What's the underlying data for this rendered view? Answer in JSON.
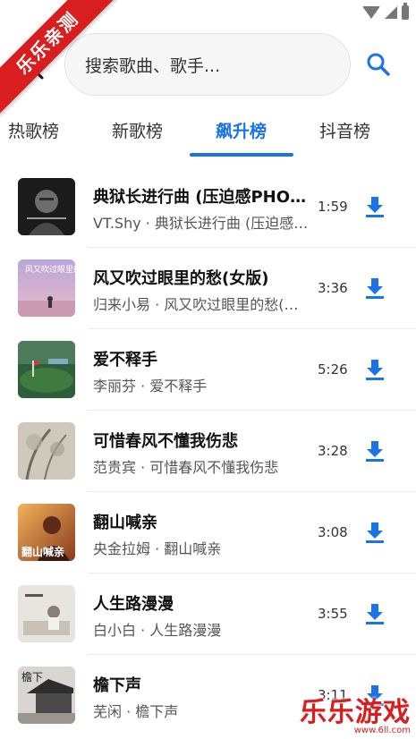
{
  "watermark": {
    "corner": "乐乐亲测",
    "bottom_title": "乐乐游戏",
    "bottom_url": "www.6ll.com"
  },
  "header": {
    "search_placeholder": "搜索歌曲、歌手..."
  },
  "tabs": [
    {
      "label": "热歌榜",
      "active": false
    },
    {
      "label": "新歌榜",
      "active": false
    },
    {
      "label": "飙升榜",
      "active": true
    },
    {
      "label": "抖音榜",
      "active": false
    }
  ],
  "songs": [
    {
      "title": "典狱长进行曲 (压迫感PHONK版)",
      "subtitle": "VT.Shy · 典狱长进行曲 (压迫感PHONK版)",
      "duration": "1:59"
    },
    {
      "title": "风又吹过眼里的愁(女版)",
      "subtitle": "归来小易 · 风又吹过眼里的愁(女版)",
      "duration": "3:36"
    },
    {
      "title": "爱不释手",
      "subtitle": "李丽芬 · 爱不释手",
      "duration": "5:26"
    },
    {
      "title": "可惜春风不懂我伤悲",
      "subtitle": "范贵宾 · 可惜春风不懂我伤悲",
      "duration": "3:28"
    },
    {
      "title": "翻山喊亲",
      "subtitle": "央金拉姆 · 翻山喊亲",
      "duration": "3:08"
    },
    {
      "title": "人生路漫漫",
      "subtitle": "白小白 · 人生路漫漫",
      "duration": "3:55"
    },
    {
      "title": "檐下声",
      "subtitle": "芜闲 · 檐下声",
      "duration": "3:11"
    }
  ],
  "cover_texts": [
    "风又吹过眼里的愁",
    "翻山喊亲",
    "檐下"
  ],
  "colors": {
    "accent": "#1a73e8",
    "watermark": "#d81e1e"
  }
}
